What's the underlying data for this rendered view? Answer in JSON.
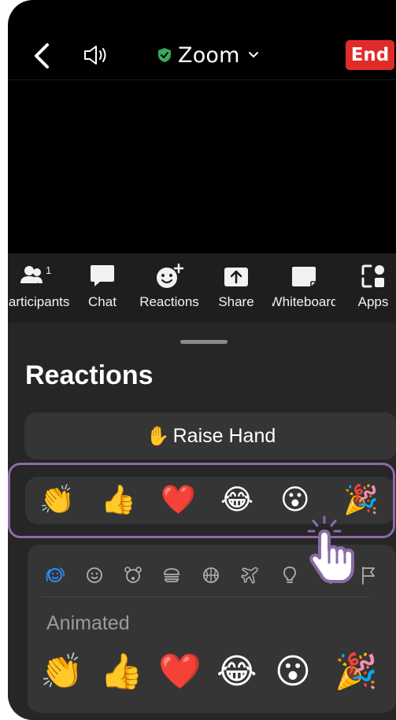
{
  "meeting": {
    "title": "Zoom",
    "end_label": "End"
  },
  "toolbar": {
    "participants": {
      "label": "Participants",
      "count": "1"
    },
    "chat": {
      "label": "Chat"
    },
    "reactions": {
      "label": "Reactions"
    },
    "share": {
      "label": "Share"
    },
    "whiteboard": {
      "label": "Whiteboard"
    },
    "apps": {
      "label": "Apps"
    }
  },
  "sheet": {
    "title": "Reactions",
    "raise_hand": {
      "icon": "✋",
      "label": "Raise Hand"
    },
    "quick_reactions": [
      "👏",
      "👍",
      "❤️",
      "😂",
      "😮",
      "🎉"
    ],
    "categories": [
      "recent-icon",
      "smiley-icon",
      "animal-icon",
      "food-icon",
      "activity-icon",
      "travel-icon",
      "bulb-icon",
      "symbol-icon",
      "flag-icon"
    ],
    "animated_label": "Animated",
    "animated_reactions": [
      "👏",
      "👍",
      "❤️",
      "😂",
      "😮",
      "🎉"
    ]
  },
  "colors": {
    "accent": "#2d8cff",
    "end": "#e02b2b",
    "highlight": "#8c6aa8",
    "sheet": "#262626"
  }
}
